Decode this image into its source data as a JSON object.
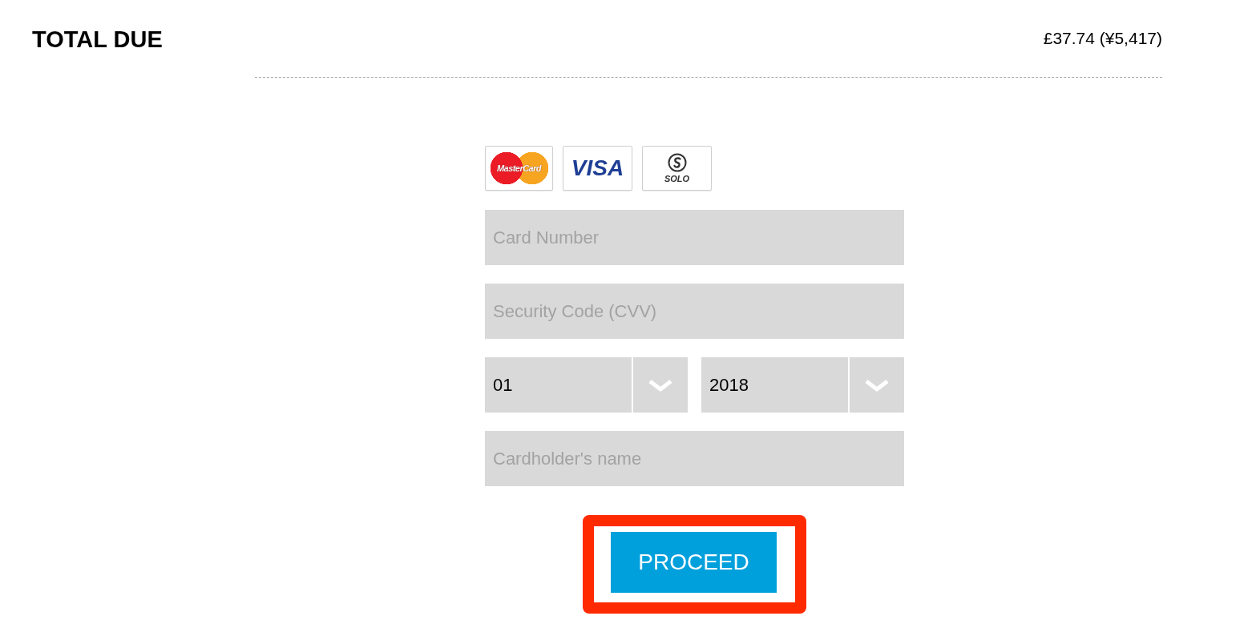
{
  "total": {
    "label": "TOTAL DUE",
    "amount": "£37.74 (¥5,417)"
  },
  "card_logos": [
    {
      "kind": "mastercard",
      "label": "MasterCard"
    },
    {
      "kind": "visa",
      "label": "VISA"
    },
    {
      "kind": "solo",
      "label": "SOLO"
    }
  ],
  "fields": [
    {
      "kind": "text",
      "placeholder": "Card Number"
    },
    {
      "kind": "text",
      "placeholder": "Security Code (CVV)"
    },
    {
      "kind": "expiry",
      "selects": [
        {
          "value": "01"
        },
        {
          "value": "2018"
        }
      ]
    },
    {
      "kind": "text",
      "placeholder": "Cardholder's name"
    }
  ],
  "button": {
    "label": "PROCEED",
    "highlighted": true
  }
}
